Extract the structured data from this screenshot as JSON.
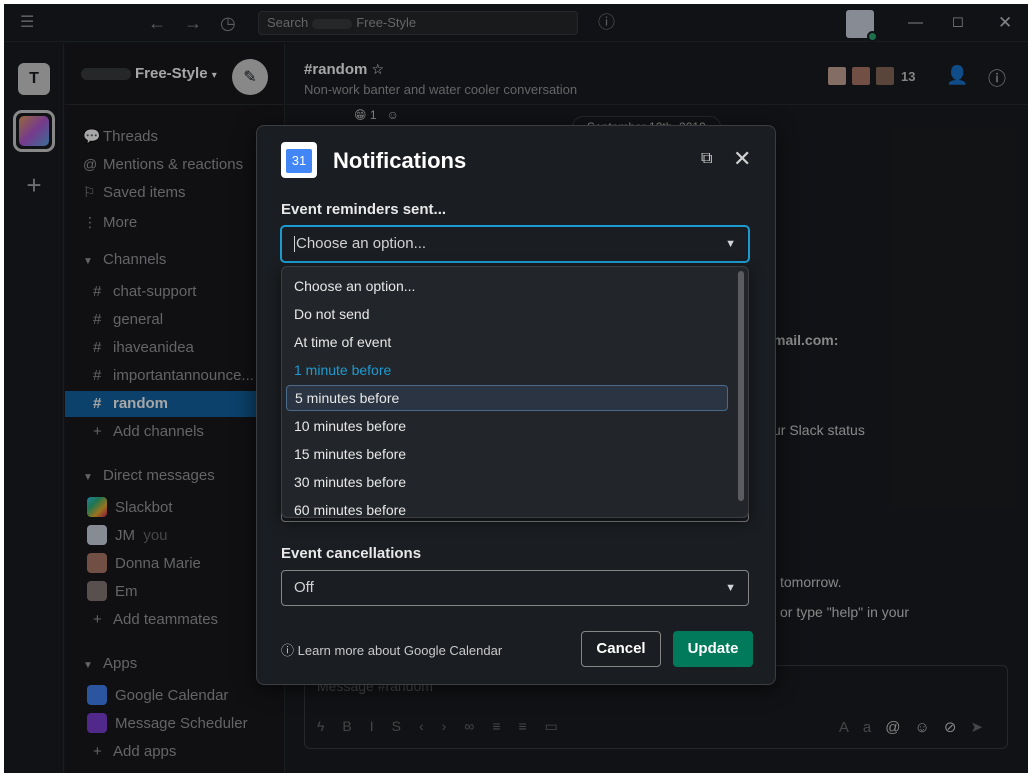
{
  "search": {
    "prefix": "Search",
    "workspace": "Free-Style"
  },
  "rail": {
    "workspace_letter": "T",
    "add_symbol": "+"
  },
  "sidebar": {
    "workspace_name": "Free-Style",
    "nav": [
      "Threads",
      "Mentions & reactions",
      "Saved items",
      "More"
    ],
    "channels_header": "Channels",
    "channels": [
      "chat-support",
      "general",
      "ihaveanidea",
      "importantannounce...",
      "random"
    ],
    "add_channels": "Add channels",
    "dm_header": "Direct messages",
    "dms": [
      {
        "name": "Slackbot",
        "suffix": ""
      },
      {
        "name": "JM",
        "suffix": "you"
      },
      {
        "name": "Donna Marie",
        "suffix": ""
      },
      {
        "name": "Em",
        "suffix": ""
      }
    ],
    "add_teammates": "Add teammates",
    "apps_header": "Apps",
    "apps": [
      "Google Calendar",
      "Message Scheduler"
    ],
    "add_apps": "Add apps"
  },
  "channel": {
    "name": "#random",
    "topic": "Non-work banter and water cooler conversation",
    "member_count": "13"
  },
  "messages": {
    "reaction_count": "1",
    "date_pill": "September 12th, 2019",
    "bg_lines": [
      "mail.com:",
      "ur Slack status",
      "tomorrow.",
      "or type \"help\" in your"
    ]
  },
  "composer": {
    "placeholder": "Message #random",
    "aa": "Aa"
  },
  "modal": {
    "logo_text": "31",
    "title": "Notifications",
    "reminders_label": "Event reminders sent...",
    "reminders_value": "Choose an option...",
    "options": [
      "Choose an option...",
      "Do not send",
      "At time of event",
      "1 minute before",
      "5 minutes before",
      "10 minutes before",
      "15 minutes before",
      "30 minutes before",
      "60 minutes before"
    ],
    "current_option_index": 3,
    "highlighted_option_index": 4,
    "cancellations_label": "Event cancellations",
    "cancellations_value": "Off",
    "learn_more": "Learn more about Google Calendar",
    "cancel_label": "Cancel",
    "update_label": "Update"
  },
  "colors": {
    "accent_blue": "#1d9bd1",
    "active_channel": "#1164a3",
    "update_green": "#007a5a",
    "presence_green": "#2bac76"
  }
}
